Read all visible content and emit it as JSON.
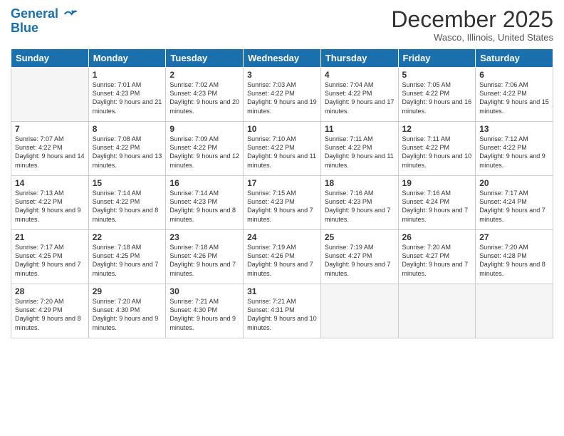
{
  "header": {
    "logo_line1": "General",
    "logo_line2": "Blue",
    "title": "December 2025",
    "location": "Wasco, Illinois, United States"
  },
  "weekdays": [
    "Sunday",
    "Monday",
    "Tuesday",
    "Wednesday",
    "Thursday",
    "Friday",
    "Saturday"
  ],
  "weeks": [
    [
      {
        "day": "",
        "empty": true
      },
      {
        "day": "1",
        "sunrise": "7:01 AM",
        "sunset": "4:23 PM",
        "daylight": "9 hours and 21 minutes."
      },
      {
        "day": "2",
        "sunrise": "7:02 AM",
        "sunset": "4:23 PM",
        "daylight": "9 hours and 20 minutes."
      },
      {
        "day": "3",
        "sunrise": "7:03 AM",
        "sunset": "4:22 PM",
        "daylight": "9 hours and 19 minutes."
      },
      {
        "day": "4",
        "sunrise": "7:04 AM",
        "sunset": "4:22 PM",
        "daylight": "9 hours and 17 minutes."
      },
      {
        "day": "5",
        "sunrise": "7:05 AM",
        "sunset": "4:22 PM",
        "daylight": "9 hours and 16 minutes."
      },
      {
        "day": "6",
        "sunrise": "7:06 AM",
        "sunset": "4:22 PM",
        "daylight": "9 hours and 15 minutes."
      }
    ],
    [
      {
        "day": "7",
        "sunrise": "7:07 AM",
        "sunset": "4:22 PM",
        "daylight": "9 hours and 14 minutes."
      },
      {
        "day": "8",
        "sunrise": "7:08 AM",
        "sunset": "4:22 PM",
        "daylight": "9 hours and 13 minutes."
      },
      {
        "day": "9",
        "sunrise": "7:09 AM",
        "sunset": "4:22 PM",
        "daylight": "9 hours and 12 minutes."
      },
      {
        "day": "10",
        "sunrise": "7:10 AM",
        "sunset": "4:22 PM",
        "daylight": "9 hours and 11 minutes."
      },
      {
        "day": "11",
        "sunrise": "7:11 AM",
        "sunset": "4:22 PM",
        "daylight": "9 hours and 11 minutes."
      },
      {
        "day": "12",
        "sunrise": "7:11 AM",
        "sunset": "4:22 PM",
        "daylight": "9 hours and 10 minutes."
      },
      {
        "day": "13",
        "sunrise": "7:12 AM",
        "sunset": "4:22 PM",
        "daylight": "9 hours and 9 minutes."
      }
    ],
    [
      {
        "day": "14",
        "sunrise": "7:13 AM",
        "sunset": "4:22 PM",
        "daylight": "9 hours and 9 minutes."
      },
      {
        "day": "15",
        "sunrise": "7:14 AM",
        "sunset": "4:22 PM",
        "daylight": "9 hours and 8 minutes."
      },
      {
        "day": "16",
        "sunrise": "7:14 AM",
        "sunset": "4:23 PM",
        "daylight": "9 hours and 8 minutes."
      },
      {
        "day": "17",
        "sunrise": "7:15 AM",
        "sunset": "4:23 PM",
        "daylight": "9 hours and 7 minutes."
      },
      {
        "day": "18",
        "sunrise": "7:16 AM",
        "sunset": "4:23 PM",
        "daylight": "9 hours and 7 minutes."
      },
      {
        "day": "19",
        "sunrise": "7:16 AM",
        "sunset": "4:24 PM",
        "daylight": "9 hours and 7 minutes."
      },
      {
        "day": "20",
        "sunrise": "7:17 AM",
        "sunset": "4:24 PM",
        "daylight": "9 hours and 7 minutes."
      }
    ],
    [
      {
        "day": "21",
        "sunrise": "7:17 AM",
        "sunset": "4:25 PM",
        "daylight": "9 hours and 7 minutes."
      },
      {
        "day": "22",
        "sunrise": "7:18 AM",
        "sunset": "4:25 PM",
        "daylight": "9 hours and 7 minutes."
      },
      {
        "day": "23",
        "sunrise": "7:18 AM",
        "sunset": "4:26 PM",
        "daylight": "9 hours and 7 minutes."
      },
      {
        "day": "24",
        "sunrise": "7:19 AM",
        "sunset": "4:26 PM",
        "daylight": "9 hours and 7 minutes."
      },
      {
        "day": "25",
        "sunrise": "7:19 AM",
        "sunset": "4:27 PM",
        "daylight": "9 hours and 7 minutes."
      },
      {
        "day": "26",
        "sunrise": "7:20 AM",
        "sunset": "4:27 PM",
        "daylight": "9 hours and 7 minutes."
      },
      {
        "day": "27",
        "sunrise": "7:20 AM",
        "sunset": "4:28 PM",
        "daylight": "9 hours and 8 minutes."
      }
    ],
    [
      {
        "day": "28",
        "sunrise": "7:20 AM",
        "sunset": "4:29 PM",
        "daylight": "9 hours and 8 minutes."
      },
      {
        "day": "29",
        "sunrise": "7:20 AM",
        "sunset": "4:30 PM",
        "daylight": "9 hours and 9 minutes."
      },
      {
        "day": "30",
        "sunrise": "7:21 AM",
        "sunset": "4:30 PM",
        "daylight": "9 hours and 9 minutes."
      },
      {
        "day": "31",
        "sunrise": "7:21 AM",
        "sunset": "4:31 PM",
        "daylight": "9 hours and 10 minutes."
      },
      {
        "day": "",
        "empty": true
      },
      {
        "day": "",
        "empty": true
      },
      {
        "day": "",
        "empty": true
      }
    ]
  ]
}
